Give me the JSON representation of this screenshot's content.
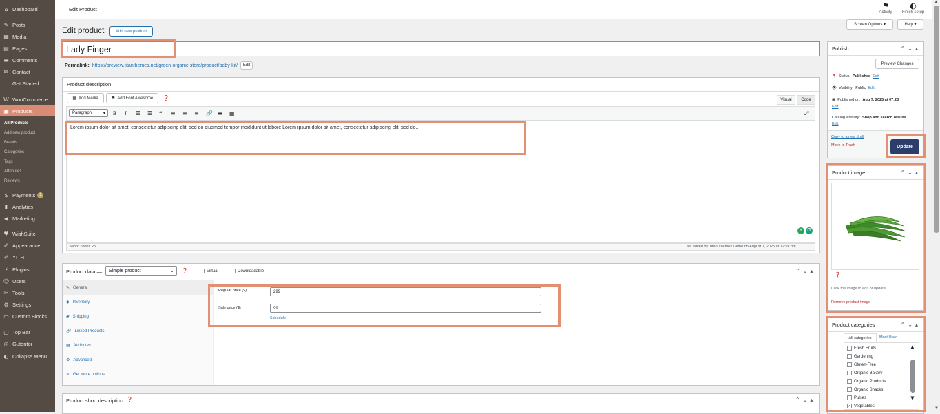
{
  "sidebar": {
    "items": [
      {
        "icon": "dashboard-icon",
        "glyph": "⌂",
        "label": "Dashboard"
      },
      {
        "icon": "pin-icon",
        "glyph": "✎",
        "label": "Posts"
      },
      {
        "icon": "media-icon",
        "glyph": "▦",
        "label": "Media"
      },
      {
        "icon": "pages-icon",
        "glyph": "▤",
        "label": "Pages"
      },
      {
        "icon": "comment-icon",
        "glyph": "▬",
        "label": "Comments"
      },
      {
        "icon": "mail-icon",
        "glyph": "✉",
        "label": "Contact"
      },
      {
        "icon": "",
        "glyph": "",
        "label": "Get Started"
      },
      {
        "icon": "woocommerce-icon",
        "glyph": "W",
        "label": "WooCommerce"
      },
      {
        "icon": "products-icon",
        "glyph": "▣",
        "label": "Products"
      }
    ],
    "products_sub": [
      "All Products",
      "Add new product",
      "Brands",
      "Categories",
      "Tags",
      "Attributes",
      "Reviews"
    ],
    "items2": [
      {
        "icon": "payments-icon",
        "glyph": "$",
        "label": "Payments",
        "badge": "1"
      },
      {
        "icon": "analytics-icon",
        "glyph": "▮",
        "label": "Analytics"
      },
      {
        "icon": "megaphone-icon",
        "glyph": "◀",
        "label": "Marketing"
      },
      {
        "icon": "heart-icon",
        "glyph": "♥",
        "label": "WishSuite"
      },
      {
        "icon": "brush-icon",
        "glyph": "✐",
        "label": "Appearance"
      },
      {
        "icon": "yith-icon",
        "glyph": "✐",
        "label": "YITH"
      },
      {
        "icon": "plugins-icon",
        "glyph": "⚡",
        "label": "Plugins"
      },
      {
        "icon": "users-icon",
        "glyph": "☺",
        "label": "Users"
      },
      {
        "icon": "tools-icon",
        "glyph": "✂",
        "label": "Tools"
      },
      {
        "icon": "settings-icon",
        "glyph": "⚙",
        "label": "Settings"
      },
      {
        "icon": "custom-blocks-icon",
        "glyph": "▭",
        "label": "Custom Blocks"
      },
      {
        "icon": "topbar-icon",
        "glyph": "▢",
        "label": "Top Bar"
      },
      {
        "icon": "gutentor-icon",
        "glyph": "◎",
        "label": "Gutentor"
      },
      {
        "icon": "collapse-icon",
        "glyph": "◐",
        "label": "Collapse Menu"
      }
    ]
  },
  "topbar": {
    "title": "Edit Product",
    "activity": "Activity",
    "finish_setup": "Finish setup"
  },
  "screen_options": "Screen Options ▾",
  "help": "Help ▾",
  "heading": {
    "title": "Edit product",
    "add_new": "Add new product"
  },
  "product_title": "Lady Finger",
  "permalink": {
    "label": "Permalink:",
    "url": "https://preview.titanthemes.net/green-organic-store/product/baby-kit/",
    "edit": "Edit"
  },
  "description": {
    "header": "Product description",
    "add_media": "Add Media",
    "add_font_awesome": "Add Font Awesome",
    "tab_visual": "Visual",
    "tab_code": "Code",
    "format": "Paragraph",
    "content": "Lorem ipsum dolor sit amet, consectetur adipiscing elit, sed do eiusmod tempor incididunt ut labore Lorem ipsum dolor sit amet, consectetur adipiscing elit, sed do...",
    "word_count": "Word count: 25",
    "last_edited": "Last edited by Titan Themes Demo on August 7, 2025 at 12:59 pm"
  },
  "product_data": {
    "label": "Product data —",
    "type": "Simple product",
    "virtual": "Virtual",
    "downloadable": "Downloadable",
    "tabs": [
      "General",
      "Inventory",
      "Shipping",
      "Linked Products",
      "Attributes",
      "Advanced",
      "Get more options"
    ],
    "regular_price_label": "Regular price ($)",
    "regular_price": "299",
    "sale_price_label": "Sale price ($)",
    "sale_price": "99",
    "schedule": "Schedule"
  },
  "short_description": {
    "header": "Product short description"
  },
  "publish": {
    "header": "Publish",
    "preview": "Preview Changes",
    "status_label": "Status:",
    "status_value": "Published",
    "visibility_label": "Visibility:",
    "visibility_value": "Public",
    "published_label": "Published on:",
    "published_value": "Aug 7, 2025 at 07:23",
    "catalog_label": "Catalog visibility:",
    "catalog_value": "Shop and search results",
    "edit": "Edit",
    "copy_draft": "Copy to a new draft",
    "trash": "Move to Trash",
    "update": "Update"
  },
  "product_image": {
    "header": "Product image",
    "hint": "Click the image to edit or update",
    "remove": "Remove product image"
  },
  "categories": {
    "header": "Product categories",
    "tab_all": "All categories",
    "tab_most": "Most Used",
    "items": [
      {
        "name": "Fresh Fruits",
        "checked": false
      },
      {
        "name": "Gardening",
        "checked": false
      },
      {
        "name": "Gluten-Free",
        "checked": false
      },
      {
        "name": "Organic Bakery",
        "checked": false
      },
      {
        "name": "Organic Products",
        "checked": false
      },
      {
        "name": "Organic Snacks",
        "checked": false
      },
      {
        "name": "Pulses",
        "checked": false
      },
      {
        "name": "Vegetables",
        "checked": true
      }
    ]
  },
  "colors": {
    "sidebar": "#544b44",
    "accent": "#e38f74",
    "update": "#2c3c6b",
    "link": "#2271b1"
  }
}
